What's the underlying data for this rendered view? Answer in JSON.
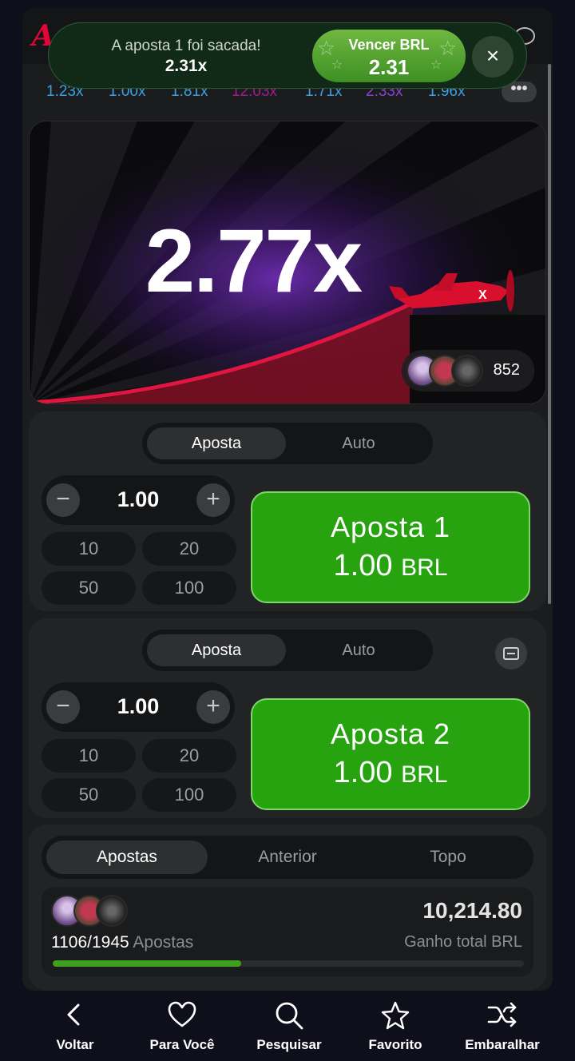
{
  "history": [
    {
      "value": "1.23x",
      "color": "#3aa0e0"
    },
    {
      "value": "1.00x",
      "color": "#3aa0e0"
    },
    {
      "value": "1.81x",
      "color": "#3aa0e0"
    },
    {
      "value": "12.03x",
      "color": "#a01a90"
    },
    {
      "value": "1.71x",
      "color": "#3aa0e0"
    },
    {
      "value": "2.33x",
      "color": "#8b3fd1"
    },
    {
      "value": "1.96x",
      "color": "#3aa0e0"
    }
  ],
  "history_more_label": "•••",
  "game": {
    "multiplier": "2.77x",
    "players_count": "852"
  },
  "toast": {
    "message": "A aposta 1 foi sacada!",
    "value": "2.31x",
    "win_label": "Vencer BRL",
    "win_value": "2.31",
    "close_icon": "×"
  },
  "bet1": {
    "tab_bet": "Aposta",
    "tab_auto": "Auto",
    "amount": "1.00",
    "minus": "−",
    "plus": "+",
    "quick": [
      "10",
      "20",
      "50",
      "100"
    ],
    "button_line1": "Aposta 1",
    "button_amount": "1.00",
    "button_currency": "BRL"
  },
  "bet2": {
    "tab_bet": "Aposta",
    "tab_auto": "Auto",
    "amount": "1.00",
    "minus": "−",
    "plus": "+",
    "quick": [
      "10",
      "20",
      "50",
      "100"
    ],
    "button_line1": "Aposta 2",
    "button_amount": "1.00",
    "button_currency": "BRL"
  },
  "stats": {
    "tabs": [
      "Apostas",
      "Anterior",
      "Topo"
    ],
    "count": "1106/1945",
    "count_label": "Apostas",
    "total": "10,214.80",
    "total_label": "Ganho total BRL",
    "progress_fraction": 0.4
  },
  "nav": [
    {
      "label": "Voltar",
      "icon": "chevron-left-icon"
    },
    {
      "label": "Para Você",
      "icon": "heart-icon"
    },
    {
      "label": "Pesquisar",
      "icon": "search-icon"
    },
    {
      "label": "Favorito",
      "icon": "star-icon"
    },
    {
      "label": "Embaralhar",
      "icon": "shuffle-icon"
    }
  ],
  "colors": {
    "accent_green": "#27a310",
    "brand_red": "#e50539",
    "background": "#0f0f1c"
  }
}
